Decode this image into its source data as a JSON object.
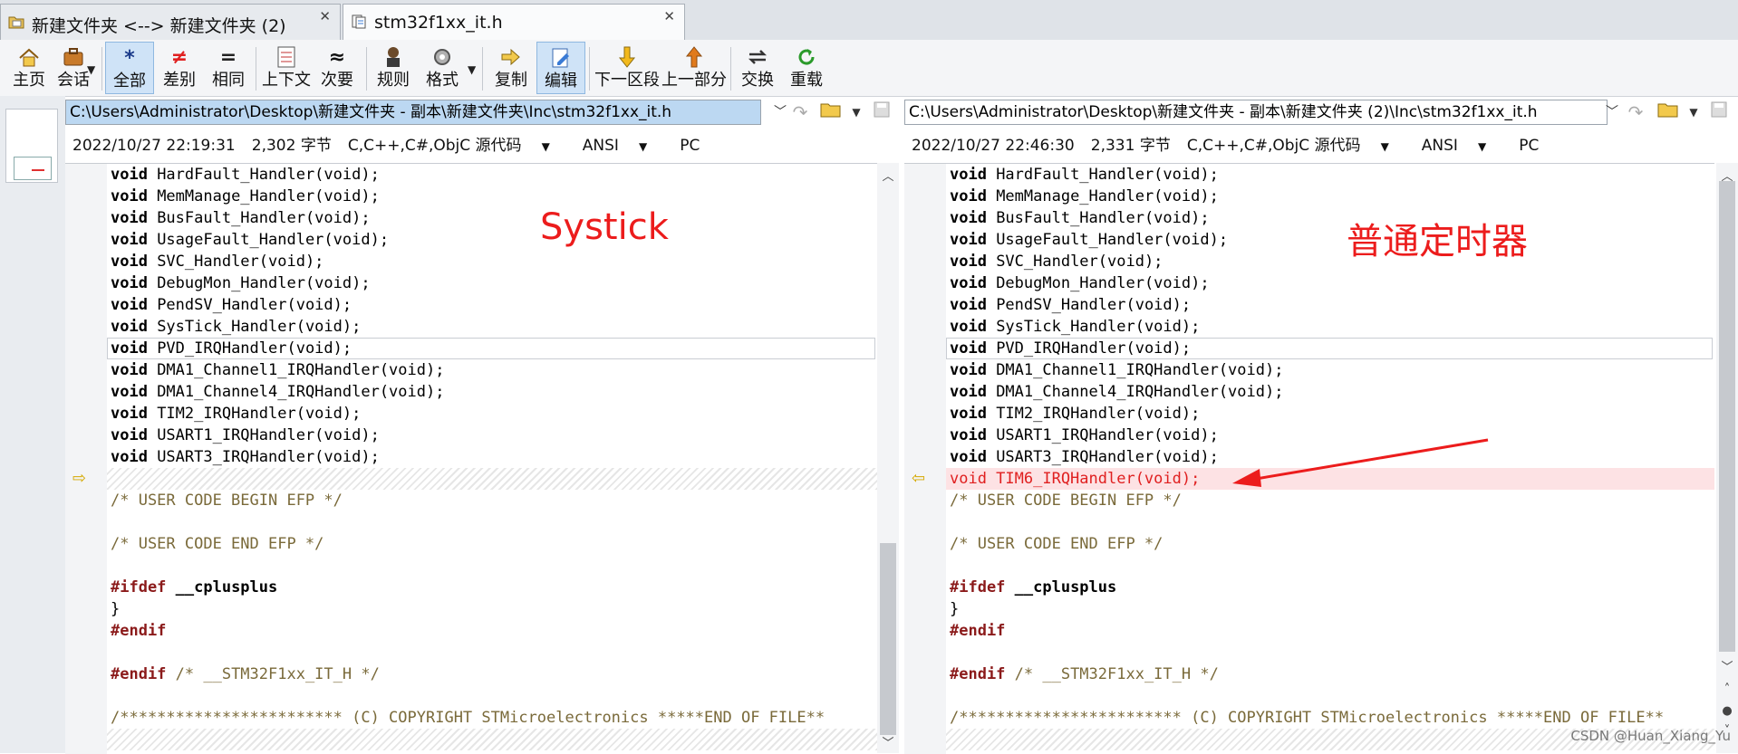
{
  "tabs": [
    {
      "label": "新建文件夹 <--> 新建文件夹 (2)",
      "close": "✕"
    },
    {
      "label": "stm32f1xx_it.h",
      "close": "✕"
    }
  ],
  "toolbar": {
    "buttons": [
      {
        "label": "主页",
        "icon": "home-icon"
      },
      {
        "label": "会话",
        "icon": "session-icon"
      },
      {
        "label": "全部",
        "icon": "all-icon",
        "glyph": "*"
      },
      {
        "label": "差别",
        "icon": "diff-icon",
        "glyph": "≠"
      },
      {
        "label": "相同",
        "icon": "same-icon",
        "glyph": "="
      },
      {
        "label": "上下文",
        "icon": "context-icon"
      },
      {
        "label": "次要",
        "icon": "minor-icon",
        "glyph": "≈"
      },
      {
        "label": "规则",
        "icon": "rules-icon"
      },
      {
        "label": "格式",
        "icon": "format-icon"
      },
      {
        "label": "复制",
        "icon": "copy-icon"
      },
      {
        "label": "编辑",
        "icon": "edit-icon"
      },
      {
        "label": "下一区段",
        "icon": "next-section-icon"
      },
      {
        "label": "上一部分",
        "icon": "prev-section-icon"
      },
      {
        "label": "交换",
        "icon": "swap-icon"
      },
      {
        "label": "重载",
        "icon": "reload-icon"
      }
    ]
  },
  "left": {
    "path": "C:\\Users\\Administrator\\Desktop\\新建文件夹 - 副本\\新建文件夹\\Inc\\stm32f1xx_it.h",
    "datetime": "2022/10/27 22:19:31",
    "size": "2,302 字节",
    "format": "C,C++,C#,ObjC 源代码",
    "encoding": "ANSI",
    "lineend": "PC",
    "overlay": "Systick"
  },
  "right": {
    "path": "C:\\Users\\Administrator\\Desktop\\新建文件夹 - 副本\\新建文件夹 (2)\\Inc\\stm32f1xx_it.h",
    "datetime": "2022/10/27 22:46:30",
    "size": "2,331 字节",
    "format": "C,C++,C#,ObjC 源代码",
    "encoding": "ANSI",
    "lineend": "PC",
    "overlay": "普通定时器"
  },
  "code": {
    "common": [
      "HardFault_Handler(void);",
      "MemManage_Handler(void);",
      "BusFault_Handler(void);",
      "UsageFault_Handler(void);",
      "SVC_Handler(void);",
      "DebugMon_Handler(void);",
      "PendSV_Handler(void);",
      "SysTick_Handler(void);",
      "PVD_IRQHandler(void);",
      "DMA1_Channel1_IRQHandler(void);",
      "DMA1_Channel4_IRQHandler(void);",
      "TIM2_IRQHandler(void);",
      "USART1_IRQHandler(void);",
      "USART3_IRQHandler(void);"
    ],
    "kw_void": "void",
    "inserted": "void TIM6_IRQHandler(void);",
    "tail": {
      "begin_efp": "/* USER CODE BEGIN EFP */",
      "end_efp": "/* USER CODE END EFP */",
      "ifdef": "#ifdef",
      "cplus": " __cplusplus",
      "brace": "}",
      "endif": "#endif",
      "endif2": "#endif",
      "guard_cmt": " /* __STM32F1xx_IT_H */",
      "copyright_left": "/************************ (C) COPYRIGHT STMicroelectronics *****END OF FILE**",
      "copyright_right": "/************************ (C) COPYRIGHT STMicroelectronics *****END OF FILE**"
    }
  },
  "watermark": "CSDN @Huan_Xiang_Yu",
  "colors": {
    "accent": "#ec1c1c",
    "diff_bg": "#fde2e4",
    "selected": "#cfe3f7"
  }
}
